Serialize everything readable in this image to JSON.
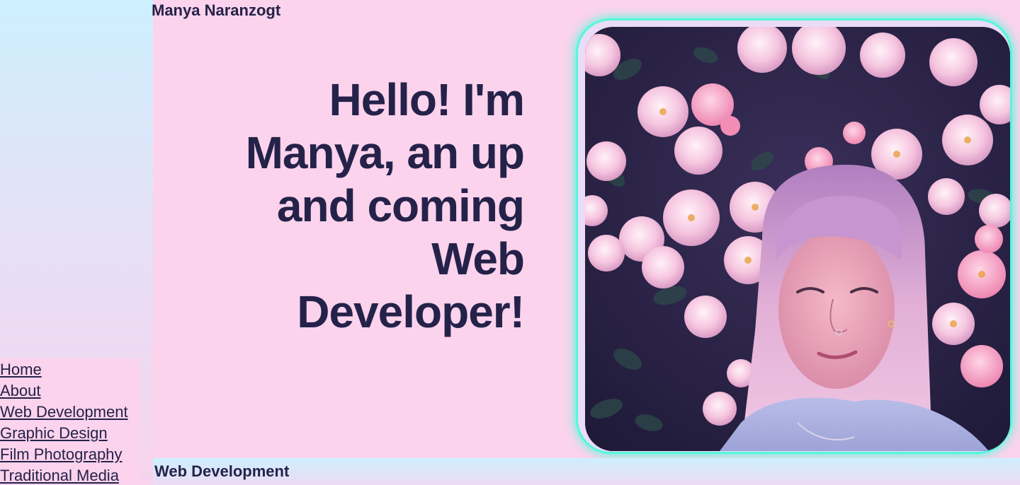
{
  "header": {
    "site_name": "Manya Naranzogt"
  },
  "hero": {
    "heading_lines": [
      "Hello! I'm",
      "Manya, an up",
      "and coming",
      "Web",
      "Developer!"
    ]
  },
  "nav": {
    "items": [
      {
        "label": "Home"
      },
      {
        "label": "About"
      },
      {
        "label": "Web Development"
      },
      {
        "label": "Graphic Design"
      },
      {
        "label": "Film Photography"
      },
      {
        "label": "Traditional Media"
      }
    ]
  },
  "section": {
    "title": "Web Development"
  },
  "photo": {
    "subject": "portrait-photo"
  },
  "colors": {
    "background": "#fbd3ec",
    "text": "#25224a",
    "frame_glow": "#57f6dc",
    "sidebar_top": "#cdf0fe"
  }
}
